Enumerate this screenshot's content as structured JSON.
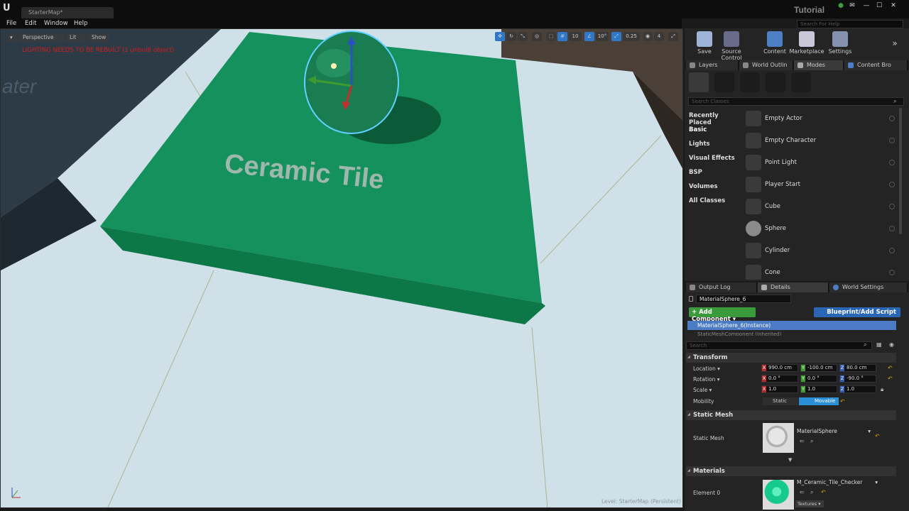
{
  "window": {
    "doc_tab": "StarterMap*",
    "project_name": "Tutorial",
    "search_help_placeholder": "Search For Help"
  },
  "menu": [
    "File",
    "Edit",
    "Window",
    "Help"
  ],
  "viewport": {
    "perspective_label": "Perspective",
    "lit_label": "Lit",
    "show_label": "Show",
    "warning": "LIGHTING NEEDS TO BE REBUILT (1 unbuilt object)",
    "wall_text": "ater",
    "floor_text": "Ceramic Tile",
    "grid_snap": "10",
    "rot_snap": "10°",
    "scale_snap": "0.25",
    "cam_speed": "4",
    "level_label": "Level:  StarterMap (Persistent)",
    "colors": {
      "tile_top": "#14915c",
      "tile_side": "#0c7848",
      "floor": "#cfe0e8"
    }
  },
  "toolbar": {
    "buttons": [
      {
        "label": "Save",
        "icon": "save-icon"
      },
      {
        "label": "Source Control",
        "icon": "source-control-icon"
      },
      {
        "label": "Content",
        "icon": "content-icon"
      },
      {
        "label": "Marketplace",
        "icon": "marketplace-icon"
      },
      {
        "label": "Settings",
        "icon": "settings-icon"
      }
    ]
  },
  "top_tabs": [
    "Layers",
    "World Outlin",
    "Modes",
    "Content Bro"
  ],
  "modes": {
    "class_search_placeholder": "Search Classes",
    "categories": [
      "Recently Placed",
      "Basic",
      "Lights",
      "Visual Effects",
      "BSP",
      "Volumes",
      "All Classes"
    ],
    "selected_category": "Basic",
    "classes": [
      "Empty Actor",
      "Empty Character",
      "Point Light",
      "Player Start",
      "Cube",
      "Sphere",
      "Cylinder",
      "Cone"
    ]
  },
  "bottom_tabs": [
    "Output Log",
    "Details",
    "World Settings"
  ],
  "details": {
    "actor_name": "MaterialSphere_6",
    "add_component": "+ Add Component ▾",
    "blueprint_button": "Blueprint/Add Script",
    "component_instance": "MaterialSphere_6(Instance)",
    "component_sub": "StaticMeshComponent (Inherited)",
    "search_placeholder": "Search",
    "transform_header": "Transform",
    "location_label": "Location ▾",
    "rotation_label": "Rotation ▾",
    "scale_label": "Scale ▾",
    "mobility_label": "Mobility",
    "location": {
      "x": "990.0 cm",
      "y": "-100.0 cm",
      "z": "80.0 cm"
    },
    "rotation": {
      "x": "0.0 °",
      "y": "0.0 °",
      "z": "-90.0 °"
    },
    "scale": {
      "x": "1.0",
      "y": "1.0",
      "z": "1.0"
    },
    "mobility_static": "Static",
    "mobility_movable": "Movable",
    "static_mesh_header": "Static Mesh",
    "static_mesh_label": "Static Mesh",
    "static_mesh_value": "MaterialSphere",
    "materials_header": "Materials",
    "element_label": "Element 0",
    "material_value": "M_Ceramic_Tile_Checker",
    "textures_label": "Textures ▾"
  }
}
